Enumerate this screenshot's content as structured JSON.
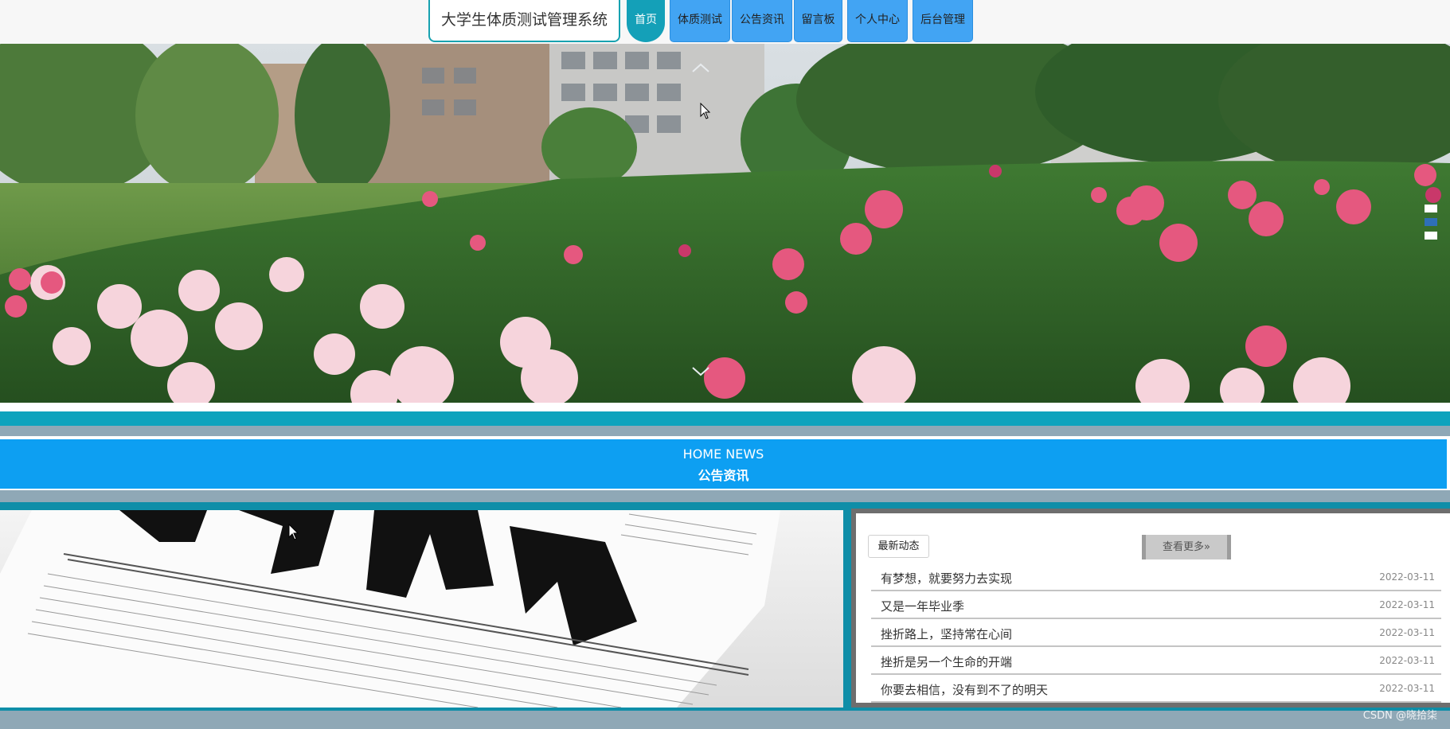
{
  "header": {
    "site_title": "大学生体质测试管理系统",
    "nav": [
      {
        "label": "首页",
        "active": true
      },
      {
        "label": "体质测试",
        "active": false
      },
      {
        "label": "公告资讯",
        "active": false
      },
      {
        "label": "留言板",
        "active": false
      },
      {
        "label": "个人中心",
        "active": false
      },
      {
        "label": "后台管理",
        "active": false
      }
    ]
  },
  "banner": {
    "image": "campus-peony-garden",
    "up_arrow_icon": "chevron-up-icon",
    "down_arrow_icon": "chevron-down-icon",
    "slides": 3,
    "active_slide": 2
  },
  "news_section": {
    "heading_en": "HOME NEWS",
    "heading_cn": "公告资讯",
    "photo": "newspaper-news-photo",
    "tag": "最新动态",
    "more_label": "查看更多»",
    "items": [
      {
        "title": "有梦想，就要努力去实现",
        "date": "2022-03-11"
      },
      {
        "title": "又是一年毕业季",
        "date": "2022-03-11"
      },
      {
        "title": "挫折路上，坚持常在心间",
        "date": "2022-03-11"
      },
      {
        "title": "挫折是另一个生命的开端",
        "date": "2022-03-11"
      },
      {
        "title": "你要去相信，没有到不了的明天",
        "date": "2022-03-11"
      }
    ]
  },
  "watermark": "CSDN @晓拾柒",
  "colors": {
    "teal": "#0ea3bd",
    "nav_blue": "#42a4f3",
    "heading_blue": "#0d9ff2",
    "gray_strip": "#8fa8b6"
  }
}
